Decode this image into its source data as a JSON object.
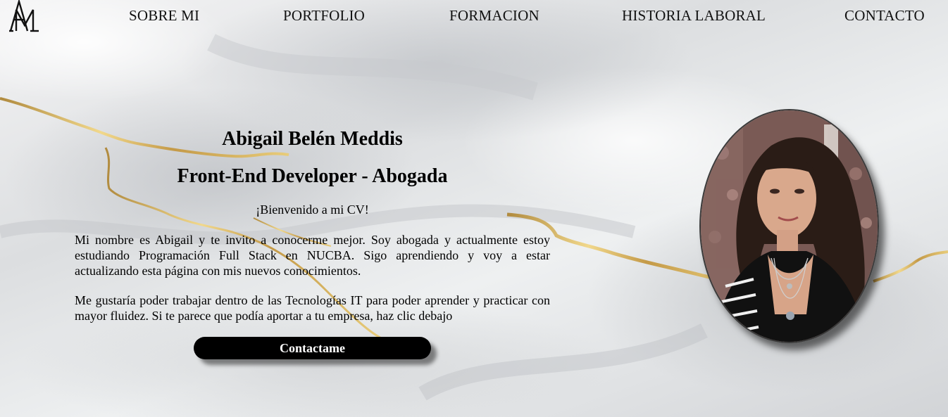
{
  "nav": {
    "logo_alt": "AM",
    "items": [
      {
        "label": "SOBRE MI"
      },
      {
        "label": "PORTFOLIO"
      },
      {
        "label": "FORMACION"
      },
      {
        "label": "HISTORIA LABORAL"
      },
      {
        "label": "CONTACTO"
      }
    ]
  },
  "hero": {
    "name": "Abigail Belén Meddis",
    "role": "Front-End Developer - Abogada",
    "welcome": "¡Bienvenido a mi CV!",
    "paragraph1": "Mi nombre es Abigail y te invito a conocerme mejor. Soy abogada y actualmente estoy estudiando Programación Full Stack en NUCBA. Sigo aprendiendo y voy a estar actualizando esta página con mis nuevos conocimientos.",
    "paragraph2": "Me gustaría poder trabajar dentro de las Tecnologías IT para poder aprender y practicar con mayor fluidez. Si te parece que podía aportar a tu empresa, haz clic debajo",
    "button_label": "Contactame"
  },
  "colors": {
    "accent_gold": "#c9a85a",
    "button_bg": "#000000",
    "button_text": "#ffffff"
  }
}
